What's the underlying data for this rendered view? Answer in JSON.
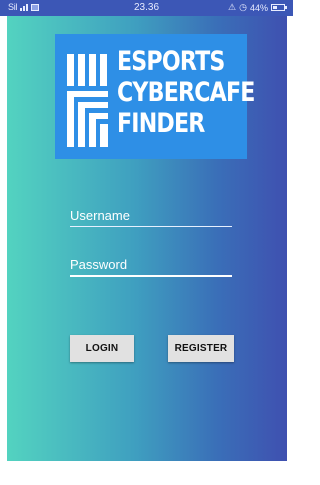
{
  "status_bar": {
    "sim_label": "Sil",
    "time": "23.36",
    "battery_percent": "44%",
    "battery_level": 0.44,
    "icons": [
      "signal-bars-icon",
      "gallery-notification-icon",
      "alarm-icon",
      "clock-icon",
      "battery-icon"
    ]
  },
  "logo": {
    "lines": [
      "ESPORTS",
      "CYBERCAFE",
      "FINDER"
    ],
    "background_color": "#2e8fe6",
    "text_color": "#ffffff"
  },
  "login_form": {
    "username_placeholder": "Username",
    "password_placeholder": "Password"
  },
  "buttons": {
    "login_label": "LOGIN",
    "register_label": "REGISTER"
  },
  "colors": {
    "gradient_left": "#53d3c0",
    "gradient_right": "#3f50b0",
    "button_bg": "#e1e1e1"
  }
}
